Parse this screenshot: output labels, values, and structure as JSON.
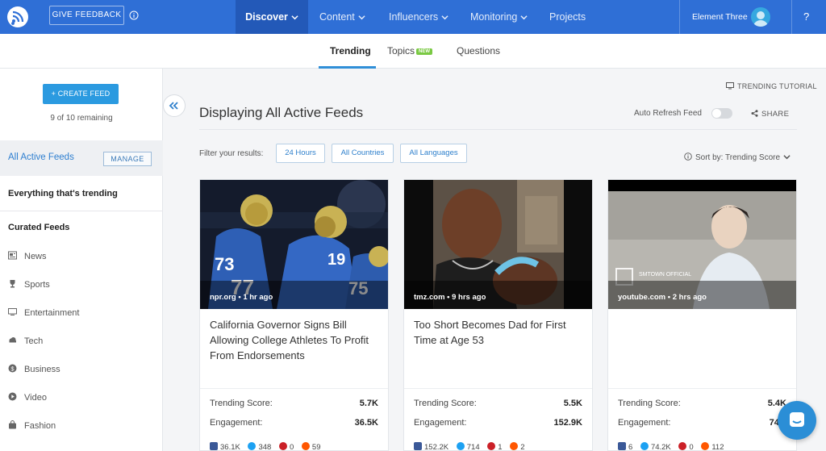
{
  "header": {
    "feedback_label": "GIVE FEEDBACK",
    "nav": [
      {
        "label": "Discover",
        "active": true
      },
      {
        "label": "Content"
      },
      {
        "label": "Influencers"
      },
      {
        "label": "Monitoring"
      },
      {
        "label": "Projects"
      }
    ],
    "user_name": "Element Three",
    "help_label": "?",
    "brand_color": "#2f6fd6"
  },
  "subtabs": [
    {
      "label": "Trending",
      "active": true
    },
    {
      "label": "Topics",
      "badge": "NEW"
    },
    {
      "label": "Questions"
    }
  ],
  "sidebar": {
    "create_label": "+ CREATE FEED",
    "remaining": "9 of 10 remaining",
    "active_feeds_label": "All Active Feeds",
    "manage_label": "MANAGE",
    "everything_label": "Everything that's trending",
    "curated_heading": "Curated Feeds",
    "items": [
      {
        "label": "News",
        "icon": "news-icon"
      },
      {
        "label": "Sports",
        "icon": "trophy-icon"
      },
      {
        "label": "Entertainment",
        "icon": "monitor-icon"
      },
      {
        "label": "Tech",
        "icon": "cloud-icon"
      },
      {
        "label": "Business",
        "icon": "dollar-icon"
      },
      {
        "label": "Video",
        "icon": "play-icon"
      },
      {
        "label": "Fashion",
        "icon": "bag-icon"
      }
    ]
  },
  "main": {
    "tutorial_label": "TRENDING TUTORIAL",
    "title": "Displaying All Active Feeds",
    "auto_refresh_label": "Auto Refresh Feed",
    "auto_refresh_on": false,
    "share_label": "SHARE",
    "filter_label": "Filter your results:",
    "filters": [
      "24 Hours",
      "All Countries",
      "All Languages"
    ],
    "sort_label": "Sort by: Trending Score"
  },
  "cards": [
    {
      "source": "npr.org • 1 hr ago",
      "headline": "California Governor Signs Bill Allowing College Athletes To Profit From Endorsements",
      "trending_label": "Trending Score:",
      "trending_score": "5.7K",
      "engagement_label": "Engagement:",
      "engagement": "36.5K",
      "facebook": "36.1K",
      "twitter": "348",
      "pinterest": "0",
      "reddit": "59"
    },
    {
      "source": "tmz.com • 9 hrs ago",
      "headline": "Too Short Becomes Dad for First Time at Age 53",
      "trending_label": "Trending Score:",
      "trending_score": "5.5K",
      "engagement_label": "Engagement:",
      "engagement": "152.9K",
      "facebook": "152.2K",
      "twitter": "714",
      "pinterest": "1",
      "reddit": "2"
    },
    {
      "source": "youtube.com • 2 hrs ago",
      "headline": "",
      "image_text": "SMTOWN OFFICIAL",
      "trending_label": "Trending Score:",
      "trending_score": "5.4K",
      "engagement_label": "Engagement:",
      "engagement": "74.3",
      "facebook": "6",
      "twitter": "74.2K",
      "pinterest": "0",
      "reddit": "112"
    }
  ]
}
